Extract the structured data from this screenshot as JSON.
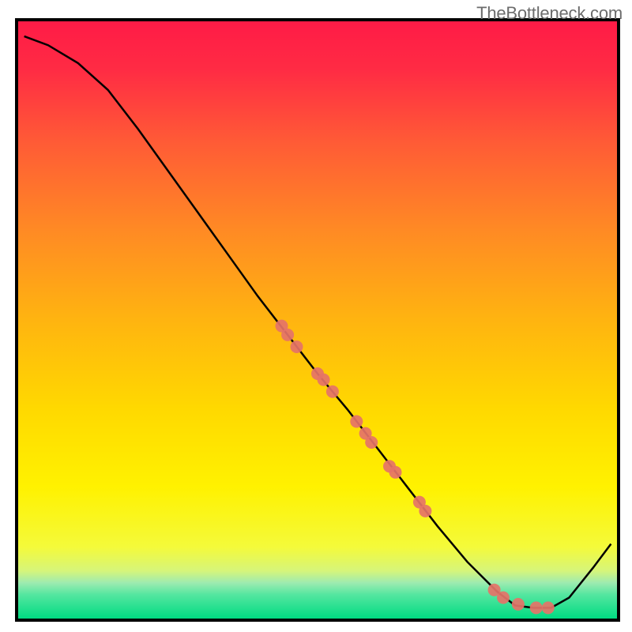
{
  "watermark": "TheBottleneck.com",
  "chart_data": {
    "type": "line",
    "title": "",
    "xlabel": "",
    "ylabel": "",
    "xlim": [
      0,
      100
    ],
    "ylim": [
      0,
      100
    ],
    "axes_visible": false,
    "grid": false,
    "background_gradient": {
      "top_color": "#ff1b46",
      "mid_color": "#ffe600",
      "bottom_band_color": "#00e676",
      "bottom_band_start": 93
    },
    "curve": {
      "description": "Bottleneck curve: high on left, descends roughly linearly, reaches minimum near x≈82-88, rises on right.",
      "points": [
        {
          "x": 1.0,
          "y": 97.5
        },
        {
          "x": 5.0,
          "y": 96.0
        },
        {
          "x": 10.0,
          "y": 93.0
        },
        {
          "x": 15.0,
          "y": 88.5
        },
        {
          "x": 20.0,
          "y": 82.0
        },
        {
          "x": 25.0,
          "y": 75.0
        },
        {
          "x": 30.0,
          "y": 68.0
        },
        {
          "x": 35.0,
          "y": 61.0
        },
        {
          "x": 40.0,
          "y": 54.0
        },
        {
          "x": 45.0,
          "y": 47.5
        },
        {
          "x": 50.0,
          "y": 41.0
        },
        {
          "x": 55.0,
          "y": 35.0
        },
        {
          "x": 60.0,
          "y": 28.5
        },
        {
          "x": 65.0,
          "y": 22.0
        },
        {
          "x": 70.0,
          "y": 15.5
        },
        {
          "x": 75.0,
          "y": 9.5
        },
        {
          "x": 80.0,
          "y": 4.5
        },
        {
          "x": 83.0,
          "y": 2.2
        },
        {
          "x": 86.0,
          "y": 1.8
        },
        {
          "x": 89.0,
          "y": 1.8
        },
        {
          "x": 92.0,
          "y": 3.5
        },
        {
          "x": 96.0,
          "y": 8.5
        },
        {
          "x": 99.0,
          "y": 12.5
        }
      ]
    },
    "markers": {
      "description": "Soft red circular markers along descending segment and valley",
      "color": "#e57368",
      "radius": 8,
      "points": [
        {
          "x": 44.0,
          "y": 49.0
        },
        {
          "x": 45.0,
          "y": 47.5
        },
        {
          "x": 46.5,
          "y": 45.5
        },
        {
          "x": 50.0,
          "y": 41.0
        },
        {
          "x": 51.0,
          "y": 40.0
        },
        {
          "x": 52.5,
          "y": 38.0
        },
        {
          "x": 56.5,
          "y": 33.0
        },
        {
          "x": 58.0,
          "y": 31.0
        },
        {
          "x": 59.0,
          "y": 29.5
        },
        {
          "x": 62.0,
          "y": 25.5
        },
        {
          "x": 63.0,
          "y": 24.5
        },
        {
          "x": 67.0,
          "y": 19.5
        },
        {
          "x": 68.0,
          "y": 18.0
        },
        {
          "x": 79.5,
          "y": 4.8
        },
        {
          "x": 81.0,
          "y": 3.5
        },
        {
          "x": 83.5,
          "y": 2.4
        },
        {
          "x": 86.5,
          "y": 1.8
        },
        {
          "x": 88.5,
          "y": 1.8
        }
      ]
    }
  }
}
